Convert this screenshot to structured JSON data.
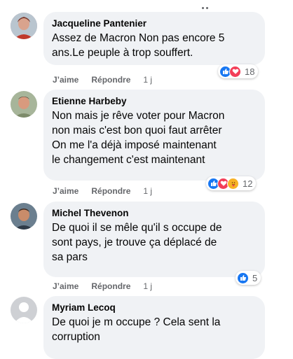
{
  "comments": [
    {
      "name": "Jacqueline Pantenier",
      "text": "Assez de Macron Non pas encore 5\nans.Le peuple à trop souffert.",
      "like_label": "J’aime",
      "reply_label": "Répondre",
      "time": "1 j",
      "reaction_icons": [
        "like-icon",
        "love-icon"
      ],
      "reaction_count": "18"
    },
    {
      "name": "Etienne Harbeby",
      "text": "Non mais je rêve voter pour Macron\nnon mais c'est bon quoi faut arrêter\nOn me l'a déjà imposé maintenant\nle changement c'est maintenant",
      "like_label": "J’aime",
      "reply_label": "Répondre",
      "time": "1 j",
      "reaction_icons": [
        "like-icon",
        "love-icon",
        "care-icon"
      ],
      "reaction_count": "12"
    },
    {
      "name": "Michel Thevenon",
      "text": "De quoi il se mêle qu'il s occupe de\nsont pays, je trouve ça déplacé de\nsa pars",
      "like_label": "J’aime",
      "reply_label": "Répondre",
      "time": "1 j",
      "reaction_icons": [
        "like-icon"
      ],
      "reaction_count": "5"
    },
    {
      "name": "Myriam Lecoq",
      "text": "De quoi je m occupe ? Cela sent la\ncorruption"
    }
  ],
  "colors": {
    "bubble": "#f0f2f5",
    "like": "#1877f2",
    "love": "#f33e58",
    "care": "#f7b125",
    "meta": "#65676b"
  }
}
